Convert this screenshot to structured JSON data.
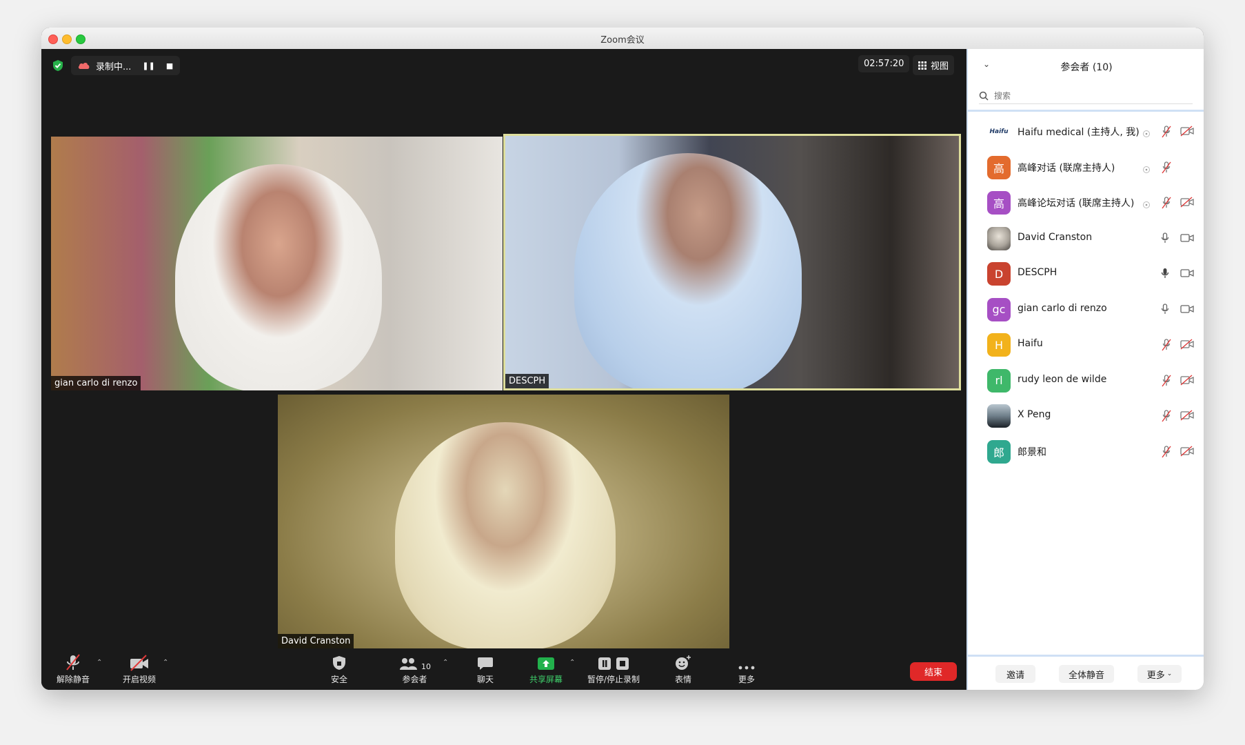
{
  "window": {
    "title": "Zoom会议"
  },
  "topbar": {
    "recording_label": "录制中...",
    "timer": "02:57:20",
    "view_label": "视图"
  },
  "videos": [
    {
      "name": "gian carlo di renzo"
    },
    {
      "name": "DESCPH"
    },
    {
      "name": "David Cranston"
    }
  ],
  "toolbar": {
    "unmute": "解除静音",
    "start_video": "开启视频",
    "security": "安全",
    "participants": "参会者",
    "participants_count": "10",
    "chat": "聊天",
    "share": "共享屏幕",
    "record": "暂停/停止录制",
    "reactions": "表情",
    "more": "更多",
    "end": "结束"
  },
  "panel": {
    "title": "参会者 (10)",
    "search_placeholder": "搜索",
    "participants": [
      {
        "name": "Haifu medical (主持人, 我)",
        "avatar": "Haifu",
        "color": "#ffffff"
      },
      {
        "name": "高峰对话 (联席主持人)",
        "avatar": "高",
        "color": "#e36b2d"
      },
      {
        "name": "高峰论坛对话 (联席主持人)",
        "avatar": "高",
        "color": "#a64fc4"
      },
      {
        "name": "David Cranston",
        "avatar": "",
        "color": "#8a8a8a"
      },
      {
        "name": "DESCPH",
        "avatar": "D",
        "color": "#c9432f"
      },
      {
        "name": "gian carlo di renzo",
        "avatar": "gc",
        "color": "#a64fc4"
      },
      {
        "name": "Haifu",
        "avatar": "H",
        "color": "#f2b21b"
      },
      {
        "name": "rudy leon de wilde",
        "avatar": "rl",
        "color": "#3fb86a"
      },
      {
        "name": "X Peng",
        "avatar": "",
        "color": "#3c4a55"
      },
      {
        "name": "郎景和",
        "avatar": "郎",
        "color": "#2fa88f"
      }
    ],
    "invite": "邀请",
    "mute_all": "全体静音",
    "more": "更多"
  }
}
